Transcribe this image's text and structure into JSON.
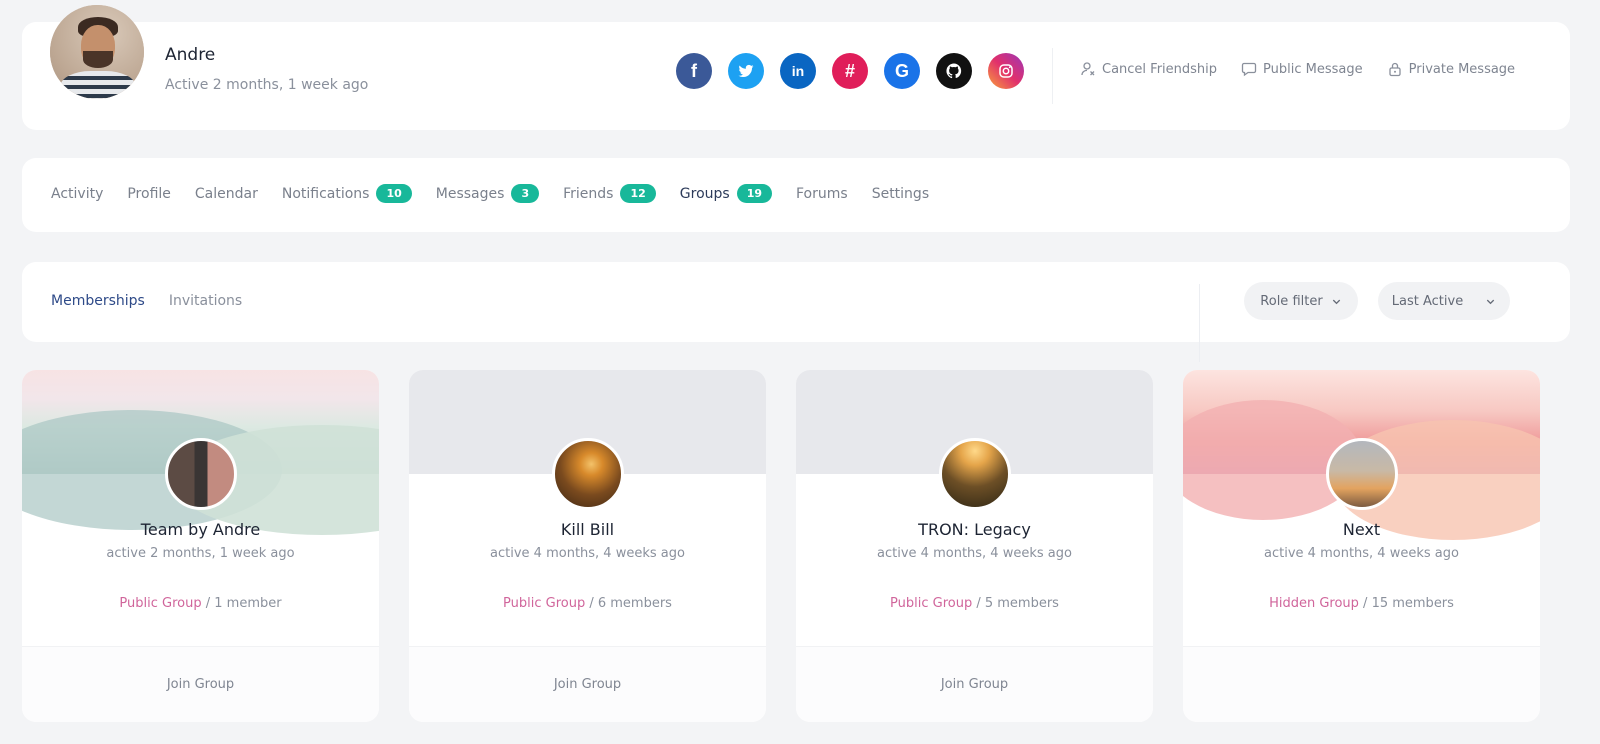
{
  "profile": {
    "name": "Andre",
    "active": "Active 2 months, 1 week ago",
    "socials": [
      {
        "name": "facebook",
        "glyph": "f",
        "color": "#3b5998"
      },
      {
        "name": "twitter",
        "glyph": "t",
        "color": "#1da1f2"
      },
      {
        "name": "linkedin",
        "glyph": "in",
        "color": "#0a66c2"
      },
      {
        "name": "slack",
        "glyph": "#",
        "color": "#e01e5a"
      },
      {
        "name": "google",
        "glyph": "G",
        "color": "#1a73e8"
      },
      {
        "name": "github",
        "glyph": "●",
        "color": "#111111"
      },
      {
        "name": "instagram",
        "glyph": "◎",
        "color": "#e1306c"
      }
    ],
    "actions": {
      "cancel_friendship": "Cancel Friendship",
      "public_message": "Public Message",
      "private_message": "Private Message"
    }
  },
  "nav": {
    "activity": "Activity",
    "profile": "Profile",
    "calendar": "Calendar",
    "notifications": "Notifications",
    "notifications_count": "10",
    "messages": "Messages",
    "messages_count": "3",
    "friends": "Friends",
    "friends_count": "12",
    "groups": "Groups",
    "groups_count": "19",
    "forums": "Forums",
    "settings": "Settings"
  },
  "subnav": {
    "memberships": "Memberships",
    "invitations": "Invitations",
    "role_filter": "Role filter",
    "sort": "Last Active"
  },
  "groups": [
    {
      "name": "Team by Andre",
      "active": "active 2 months, 1 week ago",
      "type": "Public Group",
      "members": "1 member",
      "join": "Join Group"
    },
    {
      "name": "Kill Bill",
      "active": "active 4 months, 4 weeks ago",
      "type": "Public Group",
      "members": "6 members",
      "join": "Join Group"
    },
    {
      "name": "TRON: Legacy",
      "active": "active 4 months, 4 weeks ago",
      "type": "Public Group",
      "members": "5 members",
      "join": "Join Group"
    },
    {
      "name": "Next",
      "active": "active 4 months, 4 weeks ago",
      "type": "Hidden Group",
      "members": "15 members"
    }
  ]
}
